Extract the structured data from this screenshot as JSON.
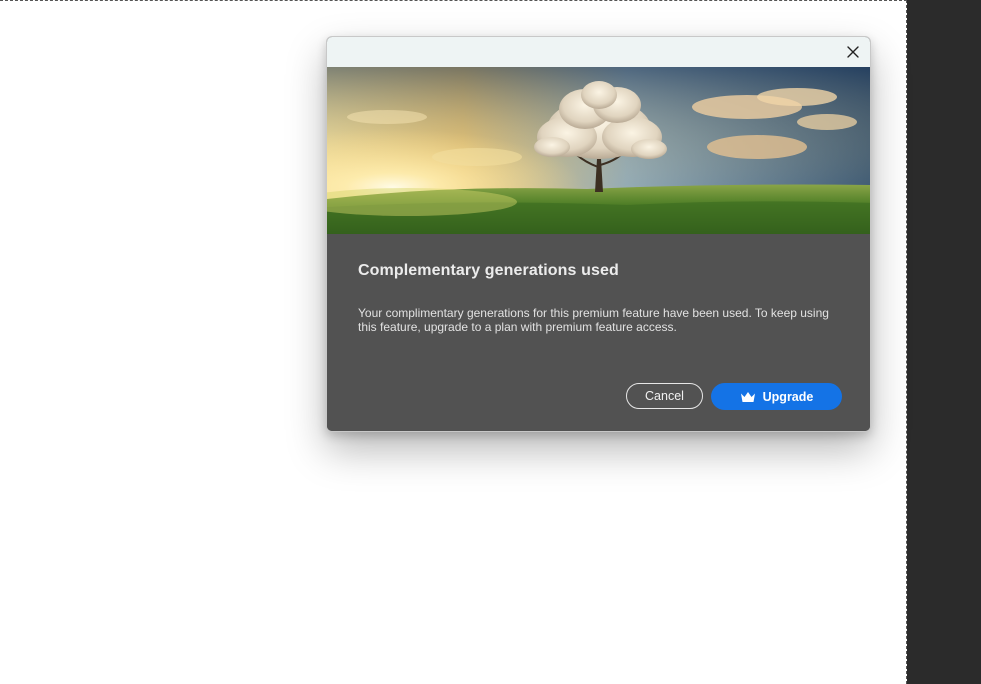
{
  "dialog": {
    "title": "Complementary generations used",
    "message": "Your complimentary generations for this premium feature have been used. To keep using this feature, upgrade to a plan with premium feature access.",
    "close_icon": "close-icon",
    "hero_image": "landscape-tree-clouds-sunset",
    "cancel_label": "Cancel",
    "upgrade_label": "Upgrade",
    "upgrade_icon": "crown-icon"
  },
  "colors": {
    "dialog_bg": "#525252",
    "titlebar_bg": "#eef4f4",
    "accent": "#1473e6",
    "canvas_bg": "#ffffff",
    "app_bg": "#2b2b2b"
  }
}
